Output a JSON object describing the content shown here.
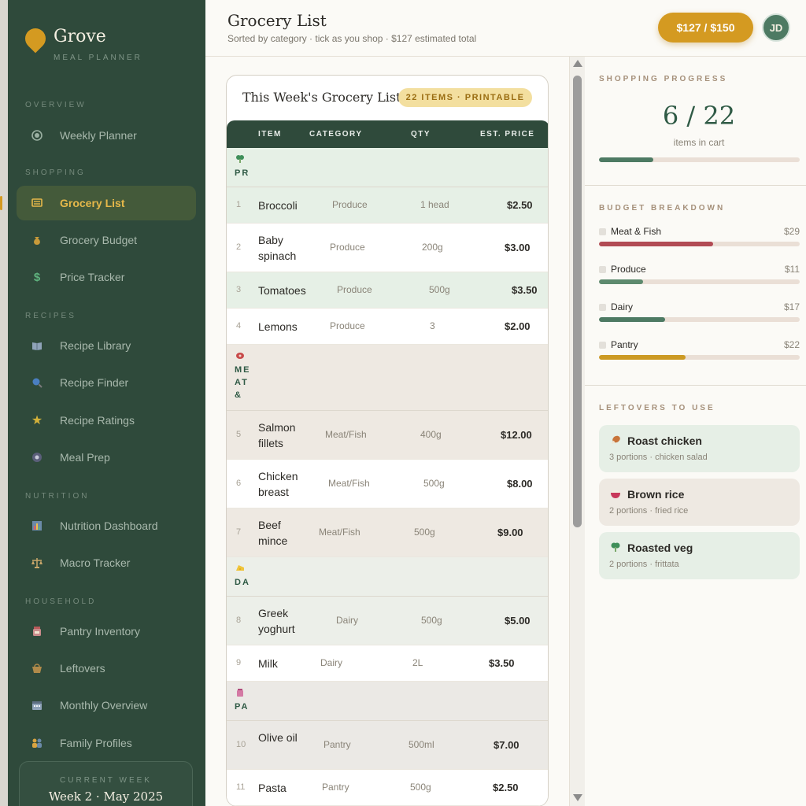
{
  "brand": {
    "title": "Grove",
    "subtitle": "MEAL PLANNER"
  },
  "sidebar": {
    "sections": [
      "OVERVIEW",
      "SHOPPING",
      "RECIPES",
      "NUTRITION",
      "HOUSEHOLD"
    ],
    "items": [
      {
        "label": "Weekly Planner",
        "icon": "plate-icon"
      },
      {
        "label": "Grocery List",
        "icon": "cart-icon"
      },
      {
        "label": "Grocery Budget",
        "icon": "money-bag-icon"
      },
      {
        "label": "Price Tracker",
        "icon": "dollar-icon"
      },
      {
        "label": "Recipe Library",
        "icon": "book-icon"
      },
      {
        "label": "Recipe Finder",
        "icon": "search-icon"
      },
      {
        "label": "Recipe Ratings",
        "icon": "star-icon"
      },
      {
        "label": "Meal Prep",
        "icon": "timer-icon"
      },
      {
        "label": "Nutrition Dashboard",
        "icon": "chart-icon"
      },
      {
        "label": "Macro Tracker",
        "icon": "scale-icon"
      },
      {
        "label": "Pantry Inventory",
        "icon": "jar-icon"
      },
      {
        "label": "Leftovers",
        "icon": "basket-icon"
      },
      {
        "label": "Monthly Overview",
        "icon": "calendar-icon"
      },
      {
        "label": "Family Profiles",
        "icon": "people-icon"
      }
    ],
    "current_week": {
      "label": "CURRENT WEEK",
      "value": "Week 2 · May 2025"
    }
  },
  "header": {
    "title": "Grocery List",
    "subtitle": "Sorted by category · tick as you shop · $127 estimated total",
    "budget": "$127 / $150",
    "avatar": "JD"
  },
  "list": {
    "title": "This Week's Grocery List",
    "badge": "22 ITEMS · PRINTABLE",
    "columns": [
      "ITEM",
      "CATEGORY",
      "QTY",
      "EST. PRICE"
    ],
    "groups": [
      {
        "name": "PRODUCE",
        "icon": "broccoli-icon"
      },
      {
        "name": "MEAT & FISH",
        "icon": "meat-icon"
      },
      {
        "name": "DAIRY",
        "icon": "cheese-icon"
      },
      {
        "name": "PANTRY",
        "icon": "jar-icon"
      }
    ],
    "rows": [
      {
        "num": "1",
        "item": "Broccoli",
        "category": "Produce",
        "qty": "1 head",
        "price": "$2.50"
      },
      {
        "num": "2",
        "item": "Baby spinach",
        "category": "Produce",
        "qty": "200g",
        "price": "$3.00"
      },
      {
        "num": "3",
        "item": "Tomatoes",
        "category": "Produce",
        "qty": "500g",
        "price": "$3.50"
      },
      {
        "num": "4",
        "item": "Lemons",
        "category": "Produce",
        "qty": "3",
        "price": "$2.00"
      },
      {
        "num": "5",
        "item": "Salmon fillets",
        "category": "Meat/Fish",
        "qty": "400g",
        "price": "$12.00"
      },
      {
        "num": "6",
        "item": "Chicken breast",
        "category": "Meat/Fish",
        "qty": "500g",
        "price": "$8.00"
      },
      {
        "num": "7",
        "item": "Beef mince",
        "category": "Meat/Fish",
        "qty": "500g",
        "price": "$9.00"
      },
      {
        "num": "8",
        "item": "Greek yoghurt",
        "category": "Dairy",
        "qty": "500g",
        "price": "$5.00"
      },
      {
        "num": "9",
        "item": "Milk",
        "category": "Dairy",
        "qty": "2L",
        "price": "$3.50"
      },
      {
        "num": "10",
        "item": "Olive oil",
        "category": "Pantry",
        "qty": "500ml",
        "price": "$7.00"
      },
      {
        "num": "11",
        "item": "Pasta",
        "category": "Pantry",
        "qty": "500g",
        "price": "$2.50"
      }
    ]
  },
  "progress": {
    "title": "SHOPPING PROGRESS",
    "count": "6 / 22",
    "label": "items in cart",
    "fraction": 0.27
  },
  "budget_breakdown": {
    "title": "BUDGET BREAKDOWN",
    "items": [
      {
        "label": "Meat & Fish",
        "amount": "$29",
        "fraction": 0.57,
        "color": "#b24b54"
      },
      {
        "label": "Produce",
        "amount": "$11",
        "fraction": 0.22,
        "color": "#5d8a6e"
      },
      {
        "label": "Dairy",
        "amount": "$17",
        "fraction": 0.33,
        "color": "#4d7a63"
      },
      {
        "label": "Pantry",
        "amount": "$22",
        "fraction": 0.43,
        "color": "#cc9a24"
      }
    ]
  },
  "leftovers": {
    "title": "LEFTOVERS TO USE",
    "items": [
      {
        "name": "Roast chicken",
        "detail": "3 portions · chicken salad",
        "icon": "drumstick-icon"
      },
      {
        "name": "Brown rice",
        "detail": "2 portions · fried rice",
        "icon": "rice-bowl-icon"
      },
      {
        "name": "Roasted veg",
        "detail": "2 portions · frittata",
        "icon": "broccoli-icon"
      }
    ]
  },
  "colors": {
    "sidebar": "#2f4a3b",
    "accent": "#d49a21",
    "primary_green": "#2f5a45"
  }
}
